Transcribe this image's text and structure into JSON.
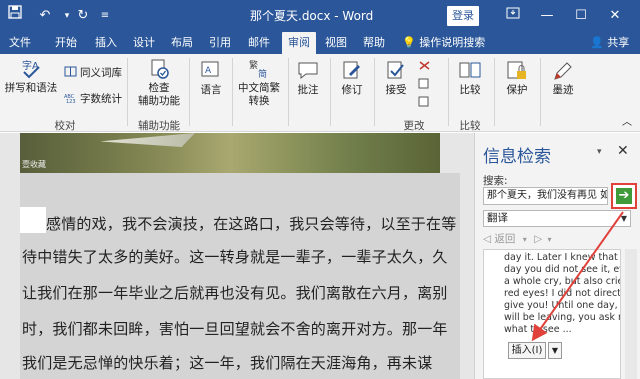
{
  "titlebar": {
    "doc_title": "那个夏天.docx  -  Word",
    "login": "登录",
    "undo_icon": "undo-icon",
    "redo_icon": "redo-icon",
    "save_icon": "save-icon"
  },
  "tabs": [
    "文件",
    "开始",
    "插入",
    "设计",
    "布局",
    "引用",
    "邮件",
    "审阅",
    "视图",
    "帮助"
  ],
  "active_tab": "审阅",
  "tell_me": "操作说明搜索",
  "share": "共享",
  "ribbon": {
    "spelling": "拼写和语法",
    "thesaurus": "同义词库",
    "word_count": "字数统计",
    "group_proofing": "校对",
    "check_acc_line1": "检查",
    "check_acc_line2": "辅助功能",
    "group_accessibility": "辅助功能",
    "language": "语言",
    "chinese_convert_line1": "中文简繁",
    "chinese_convert_line2": "转换",
    "comments": "批注",
    "track": "修订",
    "accept": "接受",
    "group_changes": "更改",
    "compare": "比较",
    "group_compare": "比较",
    "protect": "保护",
    "ink": "墨迹"
  },
  "document": {
    "photo_caption": "壹收藏",
    "lines": [
      "感情的戏，我不会演技，在这路口，我只会等待，以至于在等",
      "待中错失了太多的美好。这一转身就是一辈子，一辈子太久，久",
      "让我们在那一年毕业之后就再也没有见。我们离散在六月，离别",
      "时，我们都未回眸，害怕一旦回望就会不舍的离开对方。那一年",
      "我们是无忌惮的快乐着；这一年，我们隔在天涯海角，再未谋"
    ]
  },
  "pane": {
    "title": "信息检索",
    "search_label": "搜索:",
    "search_value": "那个夏天，我们没有再见 如",
    "source": "翻译",
    "back": "◁ 返回",
    "results": [
      "day it. Later I knew that one",
      "day you did not see it, even",
      "a whole cry, but also cried",
      "red eyes! I did not directly",
      "give you! Until one day, we",
      "will be leaving, you ask me,",
      "what to see ..."
    ],
    "insert": "插入(I)"
  },
  "colors": {
    "accent": "#2b579a",
    "go_button": "#3f9b3a",
    "highlight": "#e0423b"
  }
}
